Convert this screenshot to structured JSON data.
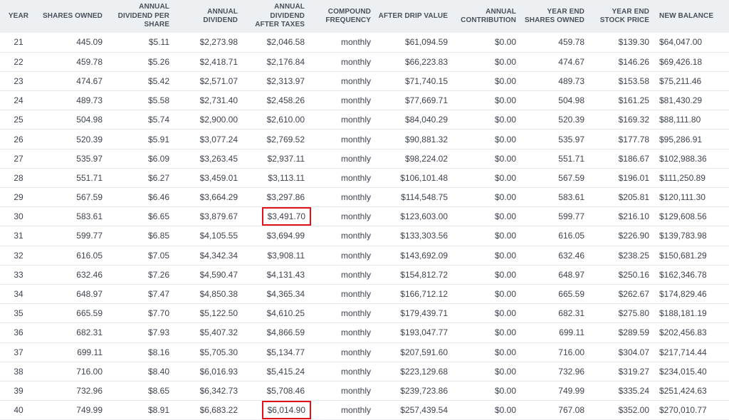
{
  "table": {
    "headers": {
      "year": "YEAR",
      "shares_owned": "SHARES OWNED",
      "annual_dividend_per_share": "ANNUAL DIVIDEND PER SHARE",
      "annual_dividend": "ANNUAL DIVIDEND",
      "annual_dividend_after_taxes": "ANNUAL DIVIDEND AFTER TAXES",
      "compound_frequency": "COMPOUND FREQUENCY",
      "after_drip_value": "AFTER DRIP VALUE",
      "annual_contribution": "ANNUAL CONTRIBUTION",
      "year_end_shares_owned": "YEAR END SHARES OWNED",
      "year_end_stock_price": "YEAR END STOCK PRICE",
      "new_balance": "NEW BALANCE"
    },
    "highlight_color": "#e3101a",
    "rows": [
      {
        "year": "21",
        "shares": "445.09",
        "dps": "$5.11",
        "div": "$2,273.98",
        "after_tax": "$2,046.58",
        "freq": "monthly",
        "drip": "$61,094.59",
        "contrib": "$0.00",
        "ye_shares": "459.78",
        "ye_price": "$139.30",
        "balance": "$64,047.00",
        "highlight": false
      },
      {
        "year": "22",
        "shares": "459.78",
        "dps": "$5.26",
        "div": "$2,418.71",
        "after_tax": "$2,176.84",
        "freq": "monthly",
        "drip": "$66,223.83",
        "contrib": "$0.00",
        "ye_shares": "474.67",
        "ye_price": "$146.26",
        "balance": "$69,426.18",
        "highlight": false
      },
      {
        "year": "23",
        "shares": "474.67",
        "dps": "$5.42",
        "div": "$2,571.07",
        "after_tax": "$2,313.97",
        "freq": "monthly",
        "drip": "$71,740.15",
        "contrib": "$0.00",
        "ye_shares": "489.73",
        "ye_price": "$153.58",
        "balance": "$75,211.46",
        "highlight": false
      },
      {
        "year": "24",
        "shares": "489.73",
        "dps": "$5.58",
        "div": "$2,731.40",
        "after_tax": "$2,458.26",
        "freq": "monthly",
        "drip": "$77,669.71",
        "contrib": "$0.00",
        "ye_shares": "504.98",
        "ye_price": "$161.25",
        "balance": "$81,430.29",
        "highlight": false
      },
      {
        "year": "25",
        "shares": "504.98",
        "dps": "$5.74",
        "div": "$2,900.00",
        "after_tax": "$2,610.00",
        "freq": "monthly",
        "drip": "$84,040.29",
        "contrib": "$0.00",
        "ye_shares": "520.39",
        "ye_price": "$169.32",
        "balance": "$88,111.80",
        "highlight": false
      },
      {
        "year": "26",
        "shares": "520.39",
        "dps": "$5.91",
        "div": "$3,077.24",
        "after_tax": "$2,769.52",
        "freq": "monthly",
        "drip": "$90,881.32",
        "contrib": "$0.00",
        "ye_shares": "535.97",
        "ye_price": "$177.78",
        "balance": "$95,286.91",
        "highlight": false
      },
      {
        "year": "27",
        "shares": "535.97",
        "dps": "$6.09",
        "div": "$3,263.45",
        "after_tax": "$2,937.11",
        "freq": "monthly",
        "drip": "$98,224.02",
        "contrib": "$0.00",
        "ye_shares": "551.71",
        "ye_price": "$186.67",
        "balance": "$102,988.36",
        "highlight": false
      },
      {
        "year": "28",
        "shares": "551.71",
        "dps": "$6.27",
        "div": "$3,459.01",
        "after_tax": "$3,113.11",
        "freq": "monthly",
        "drip": "$106,101.48",
        "contrib": "$0.00",
        "ye_shares": "567.59",
        "ye_price": "$196.01",
        "balance": "$111,250.89",
        "highlight": false
      },
      {
        "year": "29",
        "shares": "567.59",
        "dps": "$6.46",
        "div": "$3,664.29",
        "after_tax": "$3,297.86",
        "freq": "monthly",
        "drip": "$114,548.75",
        "contrib": "$0.00",
        "ye_shares": "583.61",
        "ye_price": "$205.81",
        "balance": "$120,111.30",
        "highlight": false
      },
      {
        "year": "30",
        "shares": "583.61",
        "dps": "$6.65",
        "div": "$3,879.67",
        "after_tax": "$3,491.70",
        "freq": "monthly",
        "drip": "$123,603.00",
        "contrib": "$0.00",
        "ye_shares": "599.77",
        "ye_price": "$216.10",
        "balance": "$129,608.56",
        "highlight": true
      },
      {
        "year": "31",
        "shares": "599.77",
        "dps": "$6.85",
        "div": "$4,105.55",
        "after_tax": "$3,694.99",
        "freq": "monthly",
        "drip": "$133,303.56",
        "contrib": "$0.00",
        "ye_shares": "616.05",
        "ye_price": "$226.90",
        "balance": "$139,783.98",
        "highlight": false
      },
      {
        "year": "32",
        "shares": "616.05",
        "dps": "$7.05",
        "div": "$4,342.34",
        "after_tax": "$3,908.11",
        "freq": "monthly",
        "drip": "$143,692.09",
        "contrib": "$0.00",
        "ye_shares": "632.46",
        "ye_price": "$238.25",
        "balance": "$150,681.29",
        "highlight": false
      },
      {
        "year": "33",
        "shares": "632.46",
        "dps": "$7.26",
        "div": "$4,590.47",
        "after_tax": "$4,131.43",
        "freq": "monthly",
        "drip": "$154,812.72",
        "contrib": "$0.00",
        "ye_shares": "648.97",
        "ye_price": "$250.16",
        "balance": "$162,346.78",
        "highlight": false
      },
      {
        "year": "34",
        "shares": "648.97",
        "dps": "$7.47",
        "div": "$4,850.38",
        "after_tax": "$4,365.34",
        "freq": "monthly",
        "drip": "$166,712.12",
        "contrib": "$0.00",
        "ye_shares": "665.59",
        "ye_price": "$262.67",
        "balance": "$174,829.46",
        "highlight": false
      },
      {
        "year": "35",
        "shares": "665.59",
        "dps": "$7.70",
        "div": "$5,122.50",
        "after_tax": "$4,610.25",
        "freq": "monthly",
        "drip": "$179,439.71",
        "contrib": "$0.00",
        "ye_shares": "682.31",
        "ye_price": "$275.80",
        "balance": "$188,181.19",
        "highlight": false
      },
      {
        "year": "36",
        "shares": "682.31",
        "dps": "$7.93",
        "div": "$5,407.32",
        "after_tax": "$4,866.59",
        "freq": "monthly",
        "drip": "$193,047.77",
        "contrib": "$0.00",
        "ye_shares": "699.11",
        "ye_price": "$289.59",
        "balance": "$202,456.83",
        "highlight": false
      },
      {
        "year": "37",
        "shares": "699.11",
        "dps": "$8.16",
        "div": "$5,705.30",
        "after_tax": "$5,134.77",
        "freq": "monthly",
        "drip": "$207,591.60",
        "contrib": "$0.00",
        "ye_shares": "716.00",
        "ye_price": "$304.07",
        "balance": "$217,714.44",
        "highlight": false
      },
      {
        "year": "38",
        "shares": "716.00",
        "dps": "$8.40",
        "div": "$6,016.93",
        "after_tax": "$5,415.24",
        "freq": "monthly",
        "drip": "$223,129.68",
        "contrib": "$0.00",
        "ye_shares": "732.96",
        "ye_price": "$319.27",
        "balance": "$234,015.40",
        "highlight": false
      },
      {
        "year": "39",
        "shares": "732.96",
        "dps": "$8.65",
        "div": "$6,342.73",
        "after_tax": "$5,708.46",
        "freq": "monthly",
        "drip": "$239,723.86",
        "contrib": "$0.00",
        "ye_shares": "749.99",
        "ye_price": "$335.24",
        "balance": "$251,424.63",
        "highlight": false
      },
      {
        "year": "40",
        "shares": "749.99",
        "dps": "$8.91",
        "div": "$6,683.22",
        "after_tax": "$6,014.90",
        "freq": "monthly",
        "drip": "$257,439.54",
        "contrib": "$0.00",
        "ye_shares": "767.08",
        "ye_price": "$352.00",
        "balance": "$270,010.77",
        "highlight": true
      }
    ]
  }
}
